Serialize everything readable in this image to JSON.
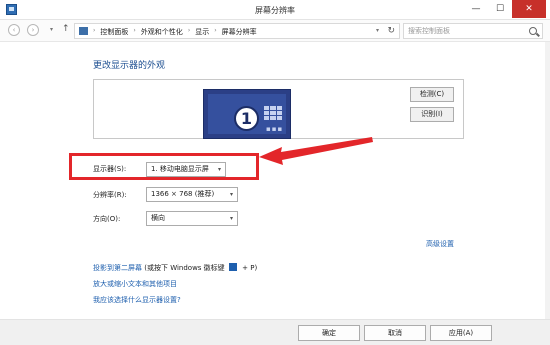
{
  "window": {
    "title": "屏幕分辨率",
    "controls": {
      "minimize": "—",
      "maximize": "☐",
      "close": "✕"
    }
  },
  "nav": {
    "back": "‹",
    "forward": "›",
    "dropdown": "▾",
    "up": "↑",
    "breadcrumb": [
      "控制面板",
      "外观和个性化",
      "显示",
      "屏幕分辨率"
    ],
    "separator": "›",
    "refresh": "↻",
    "search_placeholder": "搜索控制面板"
  },
  "main": {
    "title": "更改显示器的外观",
    "monitor_number": "1",
    "monitor_dots": "▪▪▪",
    "detect_button": "检测(C)",
    "identify_button": "识别(I)",
    "display_label": "显示器(S):",
    "display_value": "1. 移动电脑显示屏",
    "resolution_label": "分辨率(R):",
    "resolution_value": "1366 × 768 (推荐)",
    "orientation_label": "方向(O):",
    "orientation_value": "横向",
    "caret": "▾",
    "advanced_link": "高级设置",
    "project_link_text": "投影到第二屏幕",
    "project_hint_before": "(或按下 Windows 徽标键",
    "project_hint_after": "+ P)",
    "text_size_link": "放大或缩小文本和其他项目",
    "settings_help_link": "我应该选择什么显示器设置?"
  },
  "footer": {
    "ok": "确定",
    "cancel": "取消",
    "apply": "应用(A)"
  },
  "colors": {
    "highlight": "#e3262a",
    "link": "#1e5fae",
    "title": "#1d4f91",
    "monitor": "#2b3f86"
  },
  "icons": [
    "app-icon",
    "back-icon",
    "forward-icon",
    "up-arrow-icon",
    "control-panel-icon",
    "refresh-icon",
    "search-icon",
    "windows-logo-icon"
  ]
}
